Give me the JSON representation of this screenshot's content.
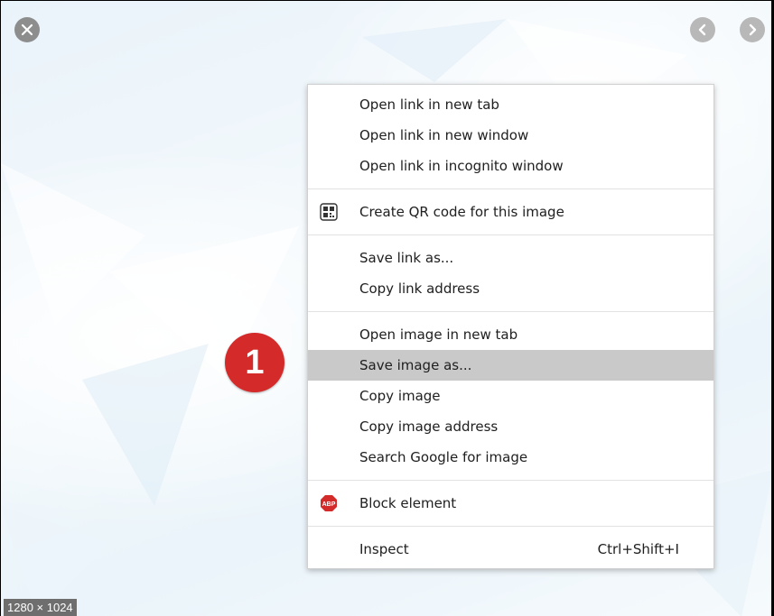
{
  "viewer": {
    "dimensions_label": "1280 × 1024"
  },
  "context_menu": {
    "groups": [
      [
        {
          "label": "Open link in new tab"
        },
        {
          "label": "Open link in new window"
        },
        {
          "label": "Open link in incognito window"
        }
      ],
      [
        {
          "label": "Create QR code for this image",
          "icon": "qr-code-icon"
        }
      ],
      [
        {
          "label": "Save link as..."
        },
        {
          "label": "Copy link address"
        }
      ],
      [
        {
          "label": "Open image in new tab"
        },
        {
          "label": "Save image as...",
          "highlighted": true
        },
        {
          "label": "Copy image"
        },
        {
          "label": "Copy image address"
        },
        {
          "label": "Search Google for image"
        }
      ],
      [
        {
          "label": "Block element",
          "icon": "adblock-plus-icon",
          "icon_text": "ABP"
        }
      ],
      [
        {
          "label": "Inspect",
          "shortcut": "Ctrl+Shift+I"
        }
      ]
    ]
  },
  "annotation": {
    "step_number": "1",
    "color": "#d42a2a"
  },
  "colors": {
    "highlight": "#c9c9c9",
    "nav_button": "#b8b8b8",
    "close_button": "#8d8d8d"
  }
}
